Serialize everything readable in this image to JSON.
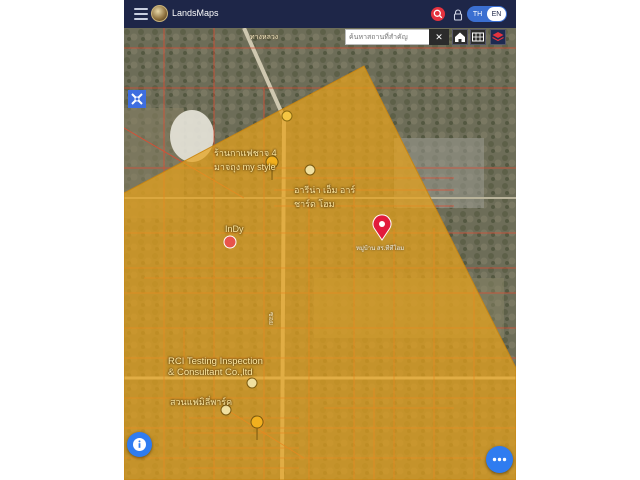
{
  "app": {
    "title": "LandsMaps",
    "lang_th": "TH",
    "lang_en": "EN"
  },
  "search": {
    "placeholder": "ค้นหาสถานที่สำคัญ",
    "clear": "✕"
  },
  "map": {
    "poi_1_line1": "ร้านกาแฟชาจ 4",
    "poi_1_line2": "มาจถุง my style",
    "poi_2_line1": "อารีน่า เอ็ม อาร์",
    "poi_2_line2": "ชาร์ด โฮม",
    "poi_indy": "InDy",
    "poi_rci_line1": "RCI Testing Inspection",
    "poi_rci_line2": "& Consultant Co.,ltd",
    "poi_bottom": "สวนแฟมิลี่พาร์ค",
    "road_1": "ทางหลวง",
    "road_2": "ซอย",
    "pin_label": "หมู่บ้าน สร.ทีทีโฮม",
    "pin_color": "#e21b3c",
    "overlay_color": "#e7a21a"
  },
  "icons": {
    "menu": "hamburger-icon",
    "search": "search-icon",
    "lock": "lock-icon",
    "home": "home-icon",
    "grid": "grid-icon",
    "layers": "layers-icon",
    "tool": "crosshair-tool-icon",
    "info": "info-icon",
    "more": "more-dots-icon"
  }
}
